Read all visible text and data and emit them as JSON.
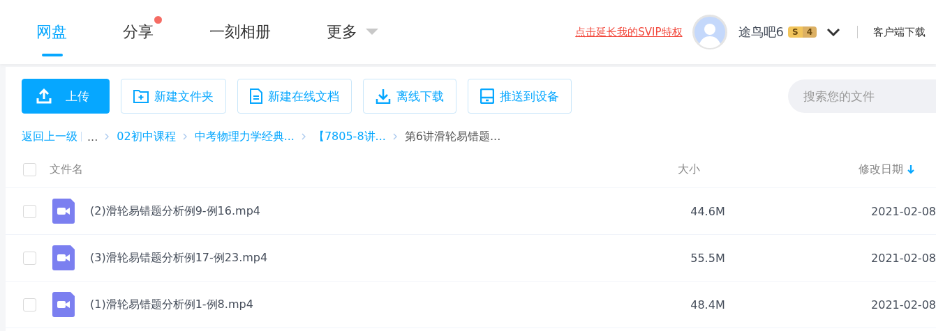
{
  "nav": {
    "tabs": [
      {
        "label": "网盘",
        "selected": true,
        "badge": false,
        "dropdown": false
      },
      {
        "label": "分享",
        "selected": false,
        "badge": true,
        "dropdown": false
      },
      {
        "label": "一刻相册",
        "selected": false,
        "badge": false,
        "dropdown": false
      },
      {
        "label": "更多",
        "selected": false,
        "badge": false,
        "dropdown": true
      }
    ],
    "promo_link": "点击延长我的SVIP特权",
    "user": {
      "name": "途鸟吧6",
      "vip_letter": "S",
      "vip_level": "4"
    },
    "client_download": "客户端下载"
  },
  "toolbar": {
    "buttons": [
      {
        "kind": "upload",
        "label": "上传",
        "primary": true
      },
      {
        "kind": "folder",
        "label": "新建文件夹",
        "primary": false
      },
      {
        "kind": "doc",
        "label": "新建在线文档",
        "primary": false
      },
      {
        "kind": "download",
        "label": "离线下载",
        "primary": false
      },
      {
        "kind": "device",
        "label": "推送到设备",
        "primary": false
      }
    ],
    "search": {
      "placeholder": "搜索您的文件"
    }
  },
  "breadcrumb": {
    "back": "返回上一级",
    "items": [
      "...",
      "02初中课程",
      "中考物理力学经典...",
      "【7805-8讲...",
      "第6讲滑轮易错题..."
    ]
  },
  "table": {
    "columns": [
      {
        "label": "文件名",
        "sorted": false
      },
      {
        "label": "大小",
        "sorted": false
      },
      {
        "label": "修改日期",
        "sorted": true
      }
    ],
    "header_checked": false,
    "rows": [
      {
        "name": "(2)滑轮易错题分析例9-例16.mp4",
        "size": "44.6M",
        "date": "2021-02-08",
        "checked": false
      },
      {
        "name": "(3)滑轮易错题分析例17-例23.mp4",
        "size": "55.5M",
        "date": "2021-02-08",
        "checked": false
      },
      {
        "name": "(1)滑轮易错题分析例1-例8.mp4",
        "size": "48.4M",
        "date": "2021-02-08",
        "checked": false
      }
    ]
  }
}
